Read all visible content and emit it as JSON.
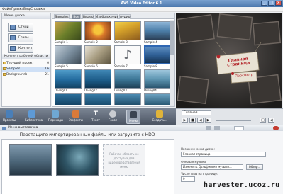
{
  "window": {
    "title": "AVS Video Editor 6.1"
  },
  "menu": [
    "Файл",
    "Правка",
    "Вид",
    "Справка"
  ],
  "sidebar": {
    "header": "Меню диска",
    "buttons": [
      "Стили",
      "Главы",
      "Контент"
    ],
    "kb_header": "Контент рабочей области",
    "tree": [
      {
        "label": "Текущий проект",
        "count": "0"
      },
      {
        "label": "Samples",
        "count": "16"
      },
      {
        "label": "Backgrounds",
        "count": "21"
      }
    ]
  },
  "gallery": {
    "tabs": [
      "Samples",
      "Все",
      "Видео",
      "Изображения",
      "Аудио"
    ],
    "thumbs": [
      "Sample 1",
      "Sample 2",
      "Sample 3",
      "Sample 4",
      "Sample 5",
      "Sample 6",
      "Sample 7",
      "Sample 8",
      "Diving01",
      "Diving02",
      "Diving03",
      "Diving04"
    ]
  },
  "preview": {
    "tag_main": "Главная страница",
    "tag_view": "Просмотр"
  },
  "toolbar": {
    "buttons": [
      "Проекты",
      "Библиотека",
      "Переходы",
      "Эффекты",
      "Текст",
      "Голос",
      "Меню",
      "Создать..."
    ]
  },
  "player": {
    "chapter_select": "Главная"
  },
  "menu_panel": {
    "header": "Меню выставочка",
    "instruction": "Перетащите импортированные файлы или загрузите с HDD",
    "placeholder": "Рабочая область не доступна для видеопредставления меню",
    "props": {
      "title_label": "Название меню диска:",
      "title_value": "Главная страница",
      "music_label": "Фоновая музыка:",
      "music_value": "Изменить Дольфинско музыки...",
      "music_btn": "Обзор...",
      "chapters_label": "Число глав на странице:",
      "chapters_value": "0"
    }
  },
  "watermark": "harvester.ucoz.ru"
}
